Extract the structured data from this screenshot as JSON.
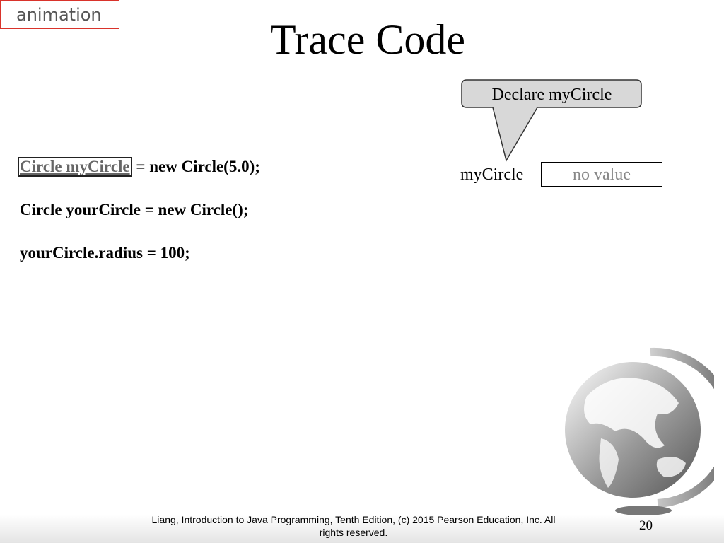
{
  "badge": {
    "label": "animation"
  },
  "slide": {
    "title": "Trace Code"
  },
  "code": {
    "line1_highlight": "Circle myCircle",
    "line1_rest": " = new Circle(5.0);",
    "line2": "Circle yourCircle = new Circle();",
    "line3": "yourCircle.radius = 100;"
  },
  "callout": {
    "text": "Declare myCircle"
  },
  "variable": {
    "name": "myCircle",
    "value": "no value"
  },
  "footer": {
    "line1": "Liang, Introduction to Java Programming, Tenth Edition, (c) 2015 Pearson Education, Inc. All",
    "line2": "rights reserved."
  },
  "page": {
    "number": "20"
  },
  "colors": {
    "badge_border": "#d9332b",
    "callout_fill": "#d8d8d8",
    "value_text": "#888888"
  },
  "icons": {
    "globe": "globe-icon"
  }
}
